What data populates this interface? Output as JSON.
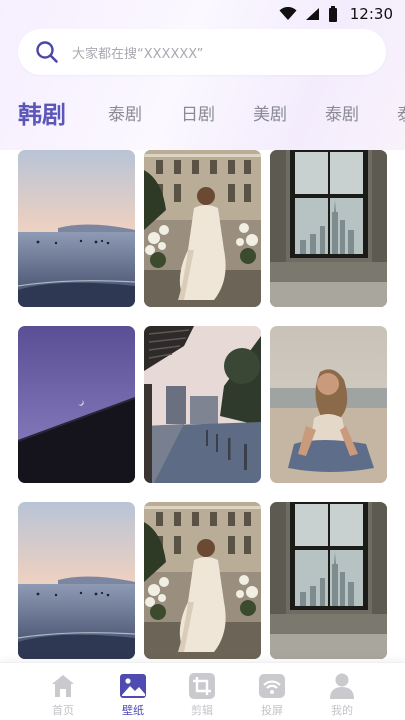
{
  "status_bar": {
    "time": "12:30",
    "icons": [
      "wifi-icon",
      "signal-icon",
      "battery-icon"
    ]
  },
  "search": {
    "placeholder": "大家都在搜“XXXXXX”",
    "icon": "search-icon"
  },
  "tabs": [
    {
      "label": "韩剧",
      "active": true
    },
    {
      "label": "泰剧",
      "active": false
    },
    {
      "label": "日剧",
      "active": false
    },
    {
      "label": "美剧",
      "active": false
    },
    {
      "label": "泰剧",
      "active": false
    },
    {
      "label": "泰",
      "active": false
    }
  ],
  "wallpapers": [
    {
      "subject": "sea-sunset-surfers"
    },
    {
      "subject": "woman-white-dress-flowers"
    },
    {
      "subject": "window-city-view"
    },
    {
      "subject": "purple-sky-moon-roof"
    },
    {
      "subject": "street-canal-evening"
    },
    {
      "subject": "woman-sitting-beach"
    },
    {
      "subject": "sea-sunset-surfers"
    },
    {
      "subject": "woman-white-dress-flowers"
    },
    {
      "subject": "window-city-view"
    }
  ],
  "bottom_nav": [
    {
      "label": "首页",
      "icon": "home-icon",
      "active": false
    },
    {
      "label": "壁纸",
      "icon": "image-icon",
      "active": true
    },
    {
      "label": "剪辑",
      "icon": "crop-icon",
      "active": false
    },
    {
      "label": "投屏",
      "icon": "cast-icon",
      "active": false
    },
    {
      "label": "我的",
      "icon": "user-icon",
      "active": false
    }
  ],
  "colors": {
    "accent": "#5b57b8",
    "inactive_tab": "#8a8a94",
    "nav_inactive": "#c3c3c8"
  }
}
